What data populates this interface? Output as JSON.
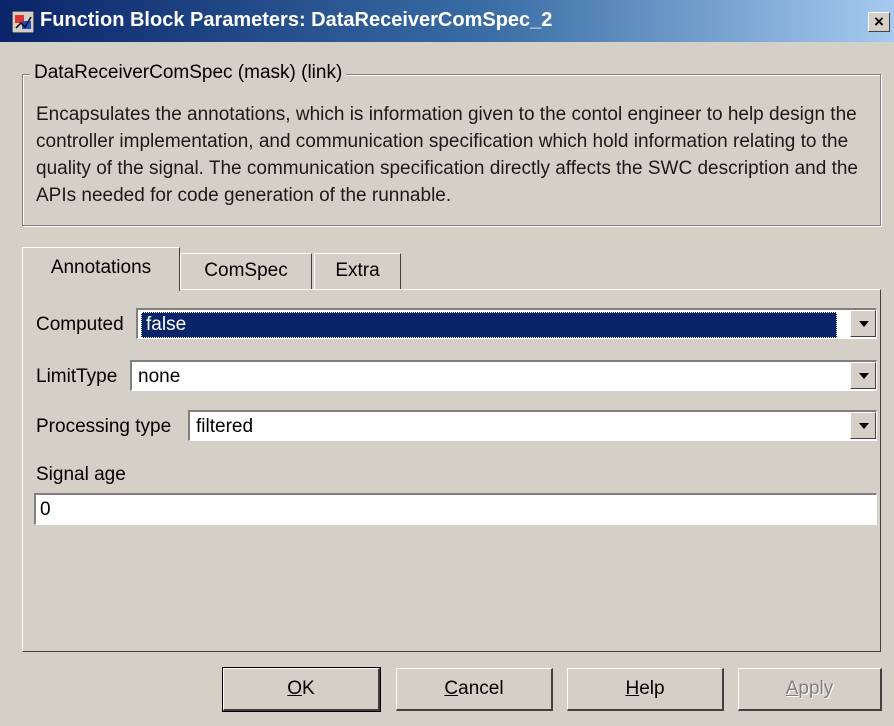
{
  "window": {
    "title": "Function Block Parameters: DataReceiverComSpec_2",
    "close_symbol": "×"
  },
  "mask": {
    "group_label": "DataReceiverComSpec (mask) (link)",
    "description": "Encapsulates the annotations, which is information given to the contol engineer to help design the controller implementation, and communication specification which hold information relating to the quality of the signal. The communication specification directly affects the SWC description and the APIs needed for code generation of the runnable."
  },
  "tabs": [
    {
      "label": "Annotations",
      "active": true
    },
    {
      "label": "ComSpec",
      "active": false
    },
    {
      "label": "Extra",
      "active": false
    }
  ],
  "annotations": {
    "computed": {
      "label": "Computed",
      "value": "false"
    },
    "limit_type": {
      "label": "LimitType",
      "value": "none"
    },
    "processing_type": {
      "label": "Processing type",
      "value": "filtered"
    },
    "signal_age": {
      "label": "Signal age",
      "value": "0"
    }
  },
  "buttons": {
    "ok": {
      "mnemonic": "O",
      "rest": "K"
    },
    "cancel": {
      "mnemonic": "C",
      "rest": "ancel"
    },
    "help": {
      "mnemonic": "H",
      "rest": "elp"
    },
    "apply": {
      "mnemonic": "A",
      "rest": "pply",
      "disabled": true
    }
  },
  "icons": {
    "app": "simulink-block-icon",
    "close": "close-icon",
    "dropdown": "chevron-down-icon"
  }
}
